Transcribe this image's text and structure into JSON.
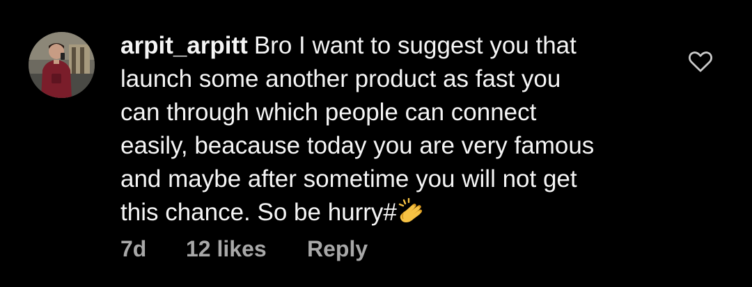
{
  "comment": {
    "username": "arpit_arpitt",
    "lines": [
      "Bro I want to suggest you that",
      "launch some another product as fast you",
      "can through which people can connect",
      "easily, beacause today you are very famous",
      "and maybe after sometime you will not get",
      "this chance. So be hurry#"
    ],
    "emoji": "clapping-hands",
    "age": "7d",
    "likes": "12 likes",
    "reply_label": "Reply",
    "liked": false
  },
  "colors": {
    "background": "#000000",
    "text": "#f5f5f5",
    "meta": "#a8a8a8",
    "clap": "#f6c244"
  }
}
